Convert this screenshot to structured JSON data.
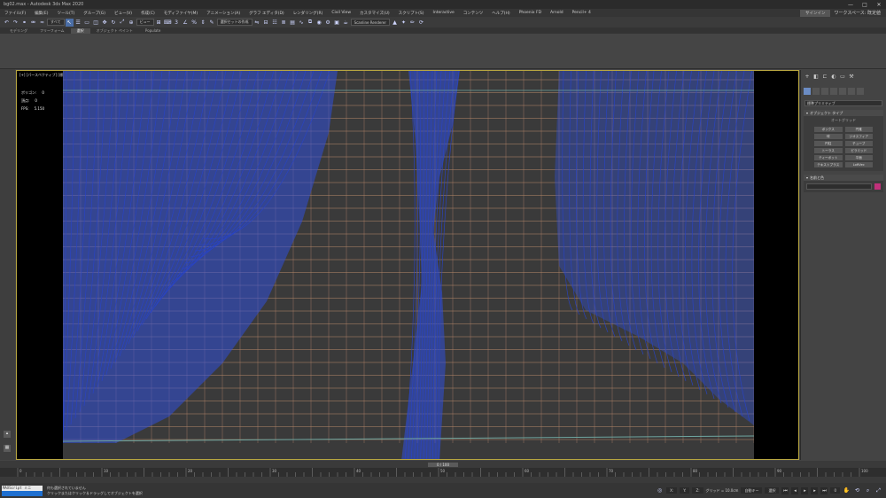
{
  "window": {
    "title": "bg02.max - Autodesk 3ds Max 2020",
    "buttons": [
      "—",
      "□",
      "✕"
    ]
  },
  "menu": {
    "items": [
      "ファイル(F)",
      "編集(E)",
      "ツール(T)",
      "グループ(G)",
      "ビュー(V)",
      "作成(C)",
      "モディファイヤ(M)",
      "アニメーション(A)",
      "グラフ エディタ(D)",
      "レンダリング(R)",
      "Civil View",
      "カスタマイズ(U)",
      "スクリプト(S)",
      "Interactive",
      "コンテンツ",
      "ヘルプ(H)",
      "Phoenix FD",
      "Arnold",
      "Pencil+ 4"
    ],
    "signin": "サインイン",
    "workspace": "ワークスペース: 既定値"
  },
  "toolbar": {
    "selection_filter": "すべて",
    "view_dropdown": "ビュー",
    "selection_set": "選択セットの作成",
    "render_dropdown": "Scanline Renderer"
  },
  "ribbon": {
    "tabs": [
      "モデリング",
      "フリーフォーム",
      "選択",
      "オブジェクト ペイント",
      "Populate"
    ],
    "active_index": 2
  },
  "viewport": {
    "label": "[+] [パースペクティブ] [標準] [ワイヤフレーム]",
    "stats": [
      {
        "label": "ポリゴン:",
        "value": "0"
      },
      {
        "label": "頂点:",
        "value": "0"
      },
      {
        "label": "FPS:",
        "value": "5.150"
      }
    ]
  },
  "command_panel": {
    "category_dropdown": "標準プリミティブ",
    "rollout_object_type": "オブジェクト タイプ",
    "autogrid": "オートグリッド",
    "buttons": [
      "ボックス",
      "円錐",
      "球",
      "ジオスフィア",
      "円柱",
      "チューブ",
      "トーラス",
      "ピラミッド",
      "ティーポット",
      "平面",
      "テキストプラス",
      "LoftVec"
    ],
    "rollout_name_color": "名前と色"
  },
  "timeline": {
    "slider": "0 / 100",
    "ticks": [
      "0",
      "10",
      "20",
      "30",
      "40",
      "50",
      "60",
      "70",
      "80",
      "90",
      "100"
    ]
  },
  "status": {
    "maxscript": "MAXScript ミニ",
    "line1": "何も選択されていません",
    "line2": "クリックまたはクリック＆ドラッグしてオブジェクトを選択",
    "grid": "グリッド = 10.0cm",
    "auto_key": "自動キー",
    "selection": "選択",
    "set_key": "キー設定",
    "frame": "0"
  },
  "colors": {
    "wire_blue": "#2f4fd8",
    "grid_line": "#b88a6a",
    "grid_minor": "#8a6a5a",
    "frame_border": "#b8a640",
    "accent": "#4b6ea6"
  }
}
